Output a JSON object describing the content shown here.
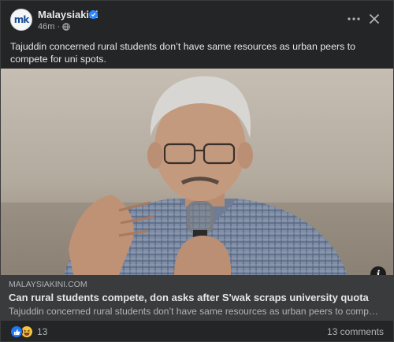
{
  "post": {
    "page_name": "Malaysiakini",
    "avatar_text": "mk",
    "time": "46m",
    "separator": "·",
    "audience_icon": "globe-icon",
    "text": "Tajuddin concerned rural students don’t have same resources as urban peers to compete for uni spots."
  },
  "link_preview": {
    "domain": "MALAYSIAKINI.COM",
    "title": "Can rural students compete, don asks after S'wak scraps university quota",
    "description": "Tajuddin concerned rural students don’t have same resources as urban peers to compete for u..."
  },
  "footer": {
    "reaction_icons": [
      "like-icon",
      "haha-icon"
    ],
    "reaction_count": "13",
    "comments": "13 comments"
  },
  "colors": {
    "card_bg": "#242526",
    "link_bg": "#3a3b3c",
    "accent_blue": "#2d88ff",
    "text_primary": "#e4e6eb",
    "text_secondary": "#b0b3b8"
  }
}
